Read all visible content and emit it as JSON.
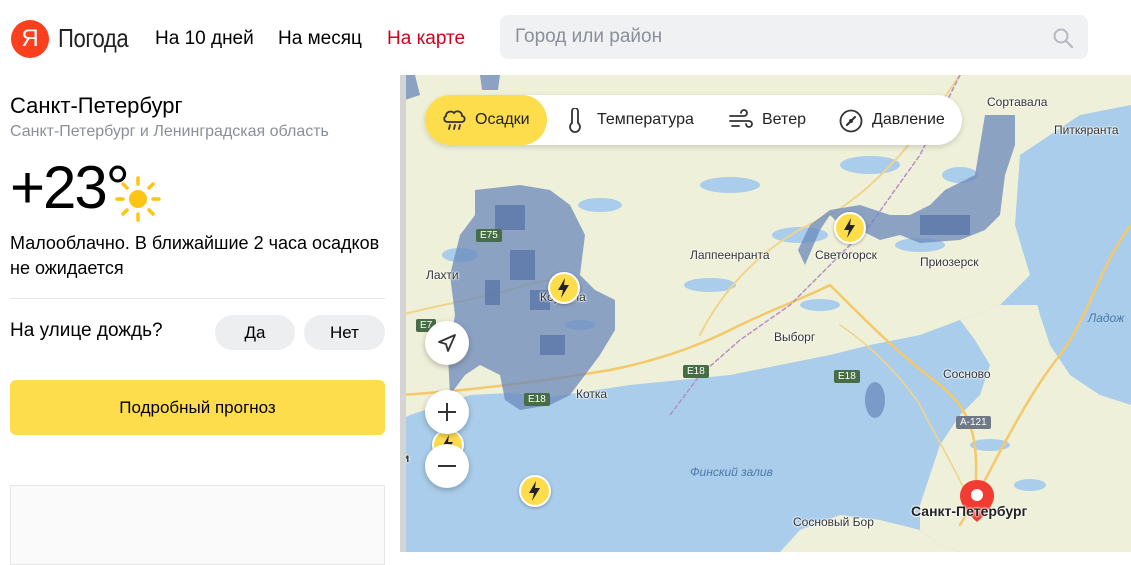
{
  "header": {
    "logo_letter": "Я",
    "logo_text": "Погода",
    "nav": [
      "На 10 дней",
      "На месяц",
      "На карте"
    ],
    "search_placeholder": "Город или район"
  },
  "panel": {
    "city": "Санкт-Петербург",
    "region": "Санкт-Петербург и Ленинградская область",
    "temperature": "+23°",
    "condition_icon": "sun-icon",
    "description": "Малооблачно. В ближайшие 2 часа осадков не ожидается",
    "question": "На улице дождь?",
    "yes_label": "Да",
    "no_label": "Нет",
    "forecast_button": "Подробный прогноз"
  },
  "map": {
    "layers": [
      "Осадки",
      "Температура",
      "Ветер",
      "Давление"
    ],
    "active_layer": "Осадки",
    "places": {
      "sortavala": "Сортавала",
      "pitkyaranta": "Питкяранта",
      "lappeenranta": "Лаппеенранта",
      "svetogorsk": "Светогорск",
      "priozersk": "Приозерск",
      "lahti": "Лахти",
      "kouvola": "Коувола",
      "vyborg": "Выборг",
      "sosnovo": "Сосново",
      "kotka": "Котка",
      "gulf": "Финский залив",
      "sosnovy_bor": "Сосновый Бор",
      "spb": "Санкт-Петербург",
      "ladoga": "Ладож",
      "edge_letter": "и"
    },
    "roads": {
      "e75": "E75",
      "e18a": "E18",
      "e18b": "E18",
      "e18c": "E18",
      "e7": "E7",
      "a121": "A-121"
    },
    "colors": {
      "land": "#eef0d9",
      "water": "#a9cdea",
      "precip": "#6b88bb",
      "accent_yellow": "#fedd4d",
      "nav_active": "#d0021b",
      "logo_red": "#fc3f1d",
      "pin_red": "#f23c32"
    }
  }
}
